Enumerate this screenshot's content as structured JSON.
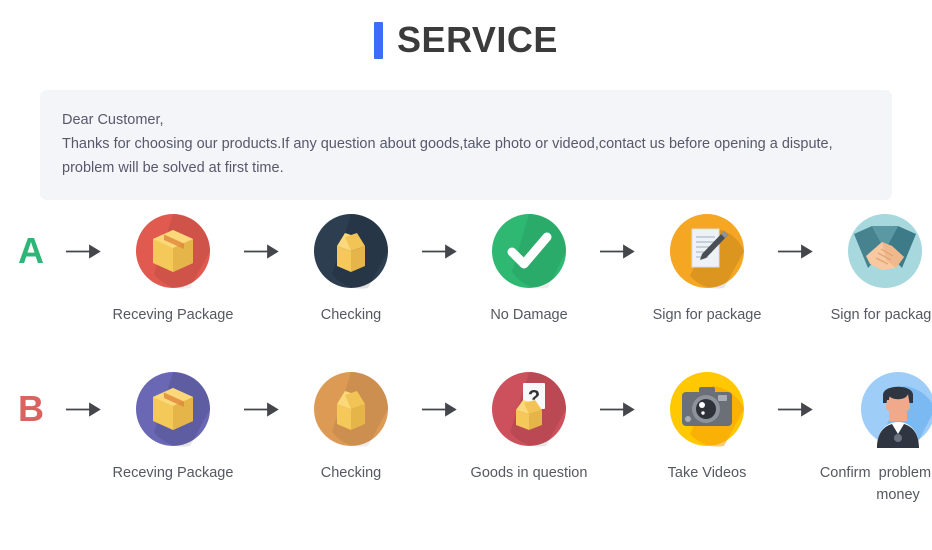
{
  "header": {
    "title": "SERVICE",
    "accent_color": "#3b6ef5",
    "title_color": "#3b3b3b"
  },
  "notice": {
    "background_color": "#f4f5f9",
    "text_color": "#56596b",
    "lines": [
      "Dear Customer,",
      "Thanks for choosing our products.If any question about goods,take photo or videod,contact us before opening a dispute,",
      "problem will be solved at first time."
    ]
  },
  "flows": [
    {
      "letter": "A",
      "letter_color": "#2fb676",
      "steps": [
        {
          "label": "Receving Package",
          "icon": "package-box-icon",
          "circle_color": "#e05a4f"
        },
        {
          "label": "Checking",
          "icon": "open-box-icon",
          "circle_color": "#2c3e50"
        },
        {
          "label": "No Damage",
          "icon": "check-mark-icon",
          "circle_color": "#2eb872"
        },
        {
          "label": "Sign for package",
          "icon": "document-pen-icon",
          "circle_color": "#f5a623"
        },
        {
          "label": "Sign for package",
          "icon": "handshake-icon",
          "circle_color": "#a6d8de"
        }
      ]
    },
    {
      "letter": "B",
      "letter_color": "#d9645f",
      "steps": [
        {
          "label": "Receving Package",
          "icon": "package-box-icon",
          "circle_color": "#6a68b5"
        },
        {
          "label": "Checking",
          "icon": "open-box-icon",
          "circle_color": "#dd9a55"
        },
        {
          "label": "Goods in question",
          "icon": "question-box-icon",
          "circle_color": "#cd515c"
        },
        {
          "label": "Take Videos",
          "icon": "camera-icon",
          "circle_color": "#ffc800"
        },
        {
          "label": "Confirm  problem,refund\nmoney",
          "icon": "person-avatar-icon",
          "circle_color": "#9ecdf7"
        }
      ]
    }
  ],
  "arrow": {
    "name": "right-arrow-icon",
    "color": "#44464b"
  }
}
